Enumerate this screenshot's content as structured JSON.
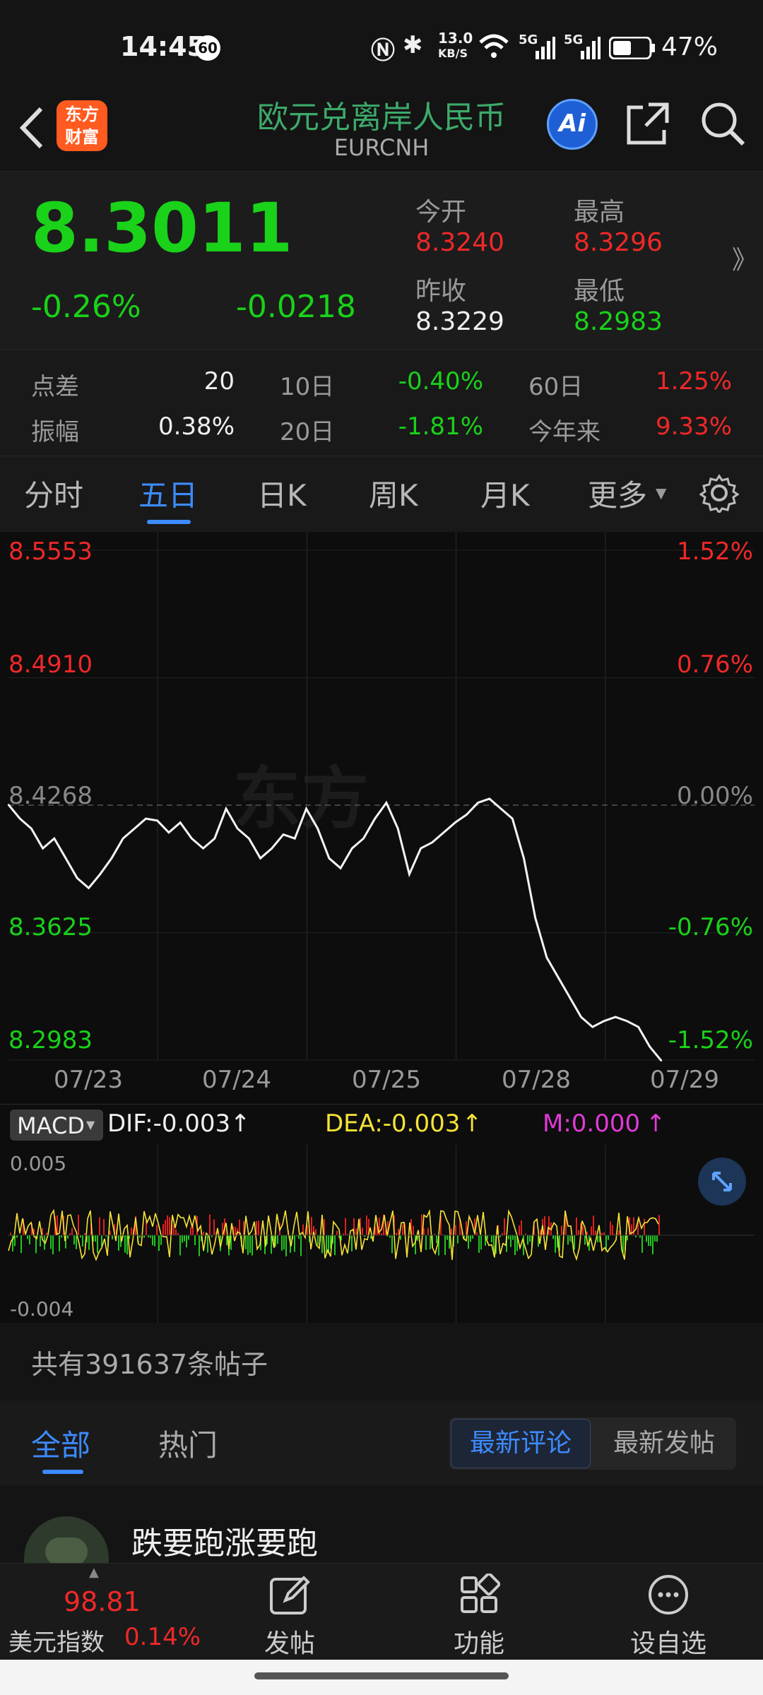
{
  "status_bar": {
    "time": "14:45",
    "notification_badge": "60",
    "net_speed_top": "13.0",
    "net_speed_bottom": "KB/S",
    "net_badge_1": "5G",
    "net_badge_2": "5G",
    "battery": "47%"
  },
  "header": {
    "title": "欧元兑离岸人民币",
    "subtitle": "EURCNH",
    "logo_line1": "东方",
    "logo_line2": "财富",
    "ai_label": "Ai"
  },
  "quote": {
    "price": "8.3011",
    "change_pct": "-0.26%",
    "change_abs": "-0.0218",
    "open_label": "今开",
    "open_value": "8.3240",
    "high_label": "最高",
    "high_value": "8.3296",
    "prev_close_label": "昨收",
    "prev_close_value": "8.3229",
    "low_label": "最低",
    "low_value": "8.2983",
    "more_glyph": "》"
  },
  "stats": {
    "spread_label": "点差",
    "spread_value": "20",
    "d10_label": "10日",
    "d10_value": "-0.40%",
    "d60_label": "60日",
    "d60_value": "1.25%",
    "amplitude_label": "振幅",
    "amplitude_value": "0.38%",
    "d20_label": "20日",
    "d20_value": "-1.81%",
    "ytd_label": "今年来",
    "ytd_value": "9.33%"
  },
  "tabs": {
    "items": [
      "分时",
      "五日",
      "日K",
      "周K",
      "月K",
      "更多"
    ],
    "active": "五日"
  },
  "chart_data": {
    "type": "line",
    "title": "",
    "y_left_ticks": [
      "8.5553",
      "8.4910",
      "8.4268",
      "8.3625",
      "8.2983"
    ],
    "y_right_ticks": [
      "1.52%",
      "0.76%",
      "0.00%",
      "-0.76%",
      "-1.52%"
    ],
    "ylim": [
      8.2983,
      8.5553
    ],
    "reference_price": 8.4268,
    "x_labels": [
      "07/23",
      "07/24",
      "07/25",
      "07/28",
      "07/29"
    ],
    "series": [
      {
        "values": [
          8.427,
          8.42,
          8.415,
          8.405,
          8.41,
          8.4,
          8.39,
          8.385,
          8.392,
          8.4,
          8.41,
          8.415,
          8.42,
          8.419,
          8.413,
          8.418,
          8.41,
          8.405,
          8.41,
          8.425,
          8.415,
          8.41,
          8.4,
          8.405,
          8.412,
          8.41,
          8.425,
          8.415,
          8.4,
          8.395,
          8.405,
          8.41,
          8.42,
          8.428,
          8.415,
          8.392,
          8.405,
          8.408,
          8.413,
          8.418,
          8.422,
          8.428,
          8.43,
          8.425,
          8.42,
          8.4,
          8.37,
          8.35,
          8.34,
          8.33,
          8.32,
          8.315,
          8.318,
          8.32,
          8.318,
          8.315,
          8.305,
          8.298
        ]
      }
    ]
  },
  "macd": {
    "selector": "MACD",
    "dif": "DIF:-0.003",
    "dea": "DEA:-0.003",
    "m": "M:0.000",
    "top_tick": "0.005",
    "bottom_tick": "-0.004"
  },
  "posts": {
    "count_text": "共有391637条帖子",
    "tab_all": "全部",
    "tab_hot": "热门",
    "sort_latest_comment": "最新评论",
    "sort_latest_post": "最新发帖",
    "first_post_author": "跌要跑涨要跑"
  },
  "bottom_nav": {
    "index_value": "98.81",
    "index_name": "美元指数",
    "index_change": "0.14%",
    "post_label": "发帖",
    "function_label": "功能",
    "watchlist_label": "设自选"
  },
  "colors": {
    "up": "#f02828",
    "down": "#19d219",
    "accent": "#3d8bff",
    "brand": "#ff5a1f",
    "title": "#3daa6a"
  }
}
